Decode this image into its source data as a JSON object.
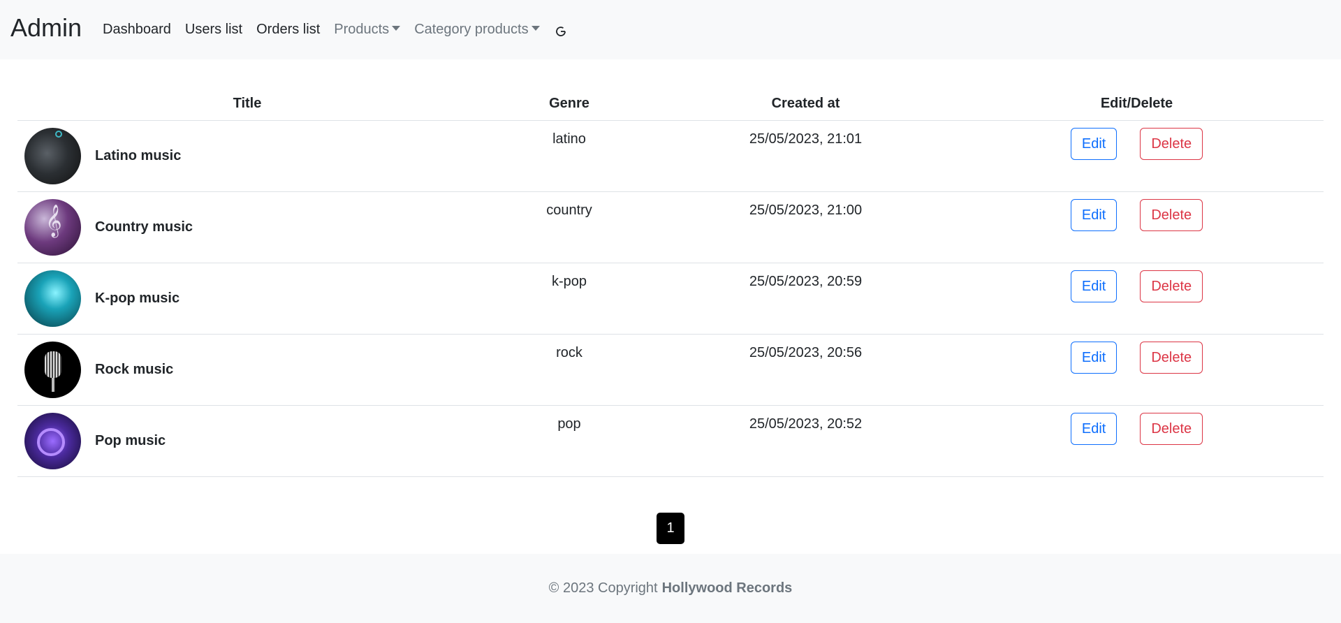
{
  "nav": {
    "brand": "Admin",
    "links": [
      "Dashboard",
      "Users list",
      "Orders list"
    ],
    "dropdowns": [
      "Products",
      "Category products"
    ]
  },
  "table": {
    "headers": [
      "Title",
      "Genre",
      "Created at",
      "Edit/Delete"
    ],
    "rows": [
      {
        "title": "Latino music",
        "genre": "latino",
        "created": "25/05/2023, 21:01"
      },
      {
        "title": "Country music",
        "genre": "country",
        "created": "25/05/2023, 21:00"
      },
      {
        "title": "K-pop music",
        "genre": "k-pop",
        "created": "25/05/2023, 20:59"
      },
      {
        "title": "Rock music",
        "genre": "rock",
        "created": "25/05/2023, 20:56"
      },
      {
        "title": "Pop music",
        "genre": "pop",
        "created": "25/05/2023, 20:52"
      }
    ],
    "edit_label": "Edit",
    "delete_label": "Delete"
  },
  "pagination": {
    "current": "1"
  },
  "footer": {
    "text": "© 2023 Copyright",
    "company": "Hollywood Records"
  },
  "colors": {
    "edit": "#0d6efd",
    "delete": "#dc3545",
    "navbar_bg": "#f8f9fa"
  }
}
